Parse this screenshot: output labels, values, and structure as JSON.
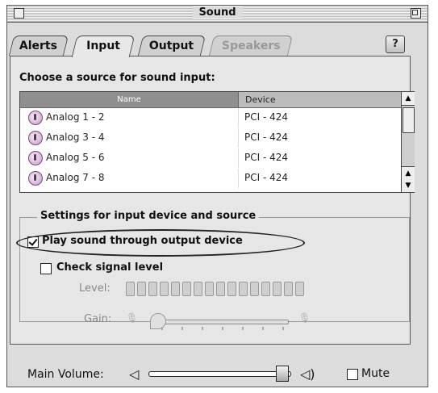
{
  "window": {
    "title": "Sound"
  },
  "tabs": [
    {
      "label": "Alerts",
      "state": "normal"
    },
    {
      "label": "Input",
      "state": "active"
    },
    {
      "label": "Output",
      "state": "normal"
    },
    {
      "label": "Speakers",
      "state": "disabled"
    }
  ],
  "help": {
    "label": "?"
  },
  "input": {
    "heading": "Choose a source for sound input:",
    "columns": [
      "Name",
      "Device"
    ],
    "sources": [
      {
        "name": "Analog 1 - 2",
        "device": "PCI - 424"
      },
      {
        "name": "Analog 3 - 4",
        "device": "PCI - 424"
      },
      {
        "name": "Analog 5 - 6",
        "device": "PCI - 424"
      },
      {
        "name": "Analog 7 - 8",
        "device": "PCI - 424"
      }
    ]
  },
  "settings": {
    "group_title": "Settings for input device and source",
    "play_through": {
      "label": "Play sound through output device",
      "checked": true
    },
    "check_signal": {
      "label": "Check signal level",
      "checked": false
    },
    "level_label": "Level:",
    "gain_label": "Gain:",
    "level_segments": 16,
    "gain_fraction": 0.0
  },
  "footer": {
    "main_volume_label": "Main Volume:",
    "volume_fraction": 0.95,
    "mute_label": "Mute",
    "mute_checked": false
  },
  "icons": [
    "close-box-icon",
    "zoom-box-icon",
    "microphone-icon",
    "speaker-low-icon",
    "speaker-high-icon",
    "arrow-up-icon",
    "arrow-down-icon"
  ]
}
